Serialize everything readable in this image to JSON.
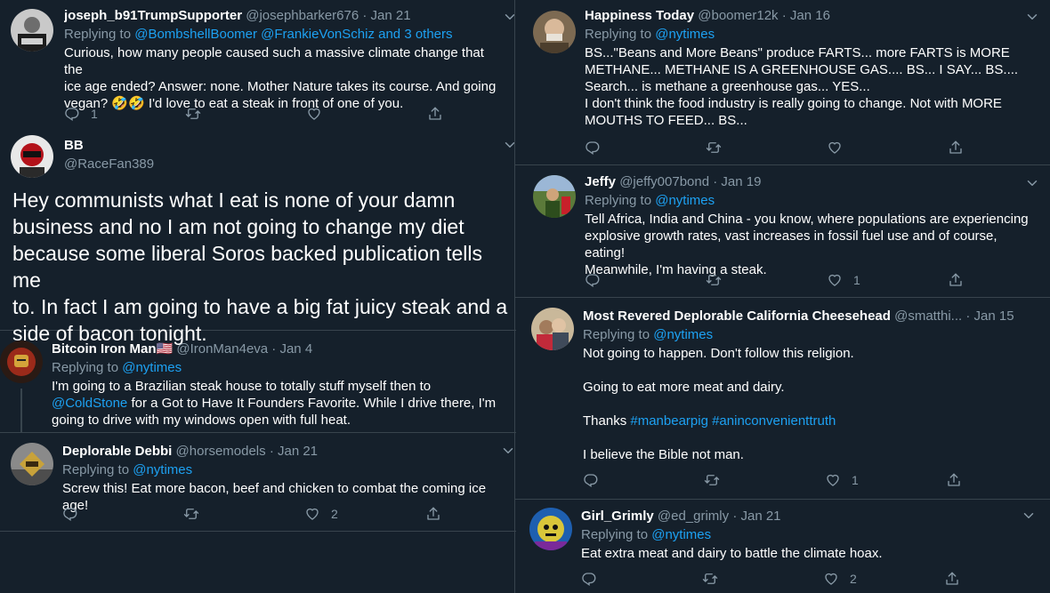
{
  "colors": {
    "background": "#15202b",
    "border": "#38444d",
    "muted": "#8899a6",
    "link": "#1da1f2",
    "text": "#ffffff"
  },
  "left": [
    {
      "name": "joseph_b91TrumpSupporter",
      "handle": "@josephbarker676",
      "sep": "·",
      "date": "Jan 21",
      "reply_prefix": "Replying to",
      "reply_to": "@BombshellBoomer @FrankieVonSchiz and 3 others",
      "lines": [
        "Curious, how many people caused such a massive climate change that the",
        "ice age ended? Answer: none. Mother Nature takes its course. And going",
        "vegan? 🤣🤣 I'd love to eat a steak in front of one of you."
      ],
      "reply_count": "1",
      "retweet_count": "",
      "like_count": ""
    },
    {
      "name": "BB",
      "handle": "@RaceFan389",
      "lines": [
        "Hey communists what I eat is none of your damn",
        "business and no I am not going to change my diet",
        "because some liberal Soros backed publication tells me",
        "to.  In fact I am going to have a big fat juicy steak and a",
        "side of bacon tonight."
      ]
    },
    {
      "name": "Bitcoin Iron Man🇺🇸",
      "handle": "@IronMan4eva",
      "sep": "·",
      "date": "Jan 4",
      "reply_prefix": "Replying to",
      "reply_to": "@nytimes",
      "line1": "I'm going to a Brazilian steak house to totally stuff myself then to",
      "line2_mention": "@ColdStone",
      "line2_rest": " for a Got to Have It Founders Favorite.  While I drive there, I'm",
      "line3": "going to drive with my windows open with full heat."
    },
    {
      "name": "Deplorable Debbi",
      "handle": "@horsemodels",
      "sep": "·",
      "date": "Jan 21",
      "reply_prefix": "Replying to",
      "reply_to": "@nytimes",
      "lines": [
        "Screw this! Eat more bacon, beef and chicken to combat the coming ice age!"
      ],
      "reply_count": "",
      "retweet_count": "",
      "like_count": "2"
    }
  ],
  "right": [
    {
      "name": "Happiness Today",
      "handle": "@boomer12k",
      "sep": "·",
      "date": "Jan 16",
      "reply_prefix": "Replying to",
      "reply_to": "@nytimes",
      "lines": [
        "BS...\"Beans and More Beans\" produce FARTS... more FARTS is MORE",
        "METHANE... METHANE IS A GREENHOUSE GAS.... BS... I SAY... BS....",
        "Search... is methane a greenhouse gas... YES...",
        "I don't think the food industry is really going to change. Not with MORE",
        "MOUTHS TO FEED... BS..."
      ],
      "reply_count": "",
      "retweet_count": "",
      "like_count": ""
    },
    {
      "name": "Jeffy",
      "handle": "@jeffy007bond",
      "sep": "·",
      "date": "Jan 19",
      "reply_prefix": "Replying to",
      "reply_to": "@nytimes",
      "lines": [
        "Tell Africa, India and China - you know, where populations are experiencing",
        "explosive growth rates, vast increases in fossil fuel use and of course, eating!",
        "Meanwhile, I'm having a steak."
      ],
      "reply_count": "",
      "retweet_count": "",
      "like_count": "1"
    },
    {
      "name": "Most Revered Deplorable California Cheesehead",
      "handle": "@smatthi...",
      "sep": "·",
      "date": "Jan 15",
      "reply_prefix": "Replying to",
      "reply_to": "@nytimes",
      "p1": "Not going to happen.  Don't follow this religion.",
      "p2": "Going to eat more meat and dairy.",
      "p3_prefix": "Thanks ",
      "tag1": "#manbearpig",
      "tag2": "#aninconvenienttruth",
      "p4": "I believe the Bible not man.",
      "reply_count": "",
      "retweet_count": "",
      "like_count": "1"
    },
    {
      "name": "Girl_Grimly",
      "handle": "@ed_grimly",
      "sep": "·",
      "date": "Jan 21",
      "reply_prefix": "Replying to",
      "reply_to": "@nytimes",
      "lines": [
        "Eat extra meat and dairy to battle the climate hoax."
      ],
      "reply_count": "",
      "retweet_count": "",
      "like_count": "2"
    }
  ],
  "icons": {
    "reply": "reply-icon",
    "retweet": "retweet-icon",
    "like": "heart-icon",
    "share": "share-icon",
    "menu": "chevron-down-icon"
  }
}
